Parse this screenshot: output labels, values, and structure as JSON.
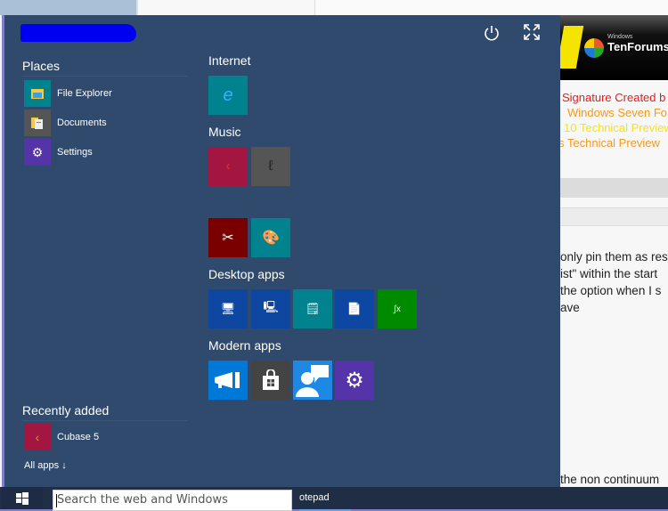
{
  "start_menu": {
    "user_name": "[redacted]",
    "power_icon": "power-icon",
    "expand_icon": "expand-icon",
    "places": {
      "heading": "Places",
      "items": [
        {
          "label": "File Explorer",
          "icon": "folder-icon",
          "color": "#00838f"
        },
        {
          "label": "Documents",
          "icon": "documents-icon",
          "color": "#555555"
        },
        {
          "label": "Settings",
          "icon": "gear-icon",
          "color": "#5533a8"
        }
      ]
    },
    "recently_added": {
      "heading": "Recently added",
      "items": [
        {
          "label": "Cubase 5",
          "icon": "cubase-icon",
          "color": "#a31642"
        }
      ]
    },
    "all_apps_label": "All apps ↓",
    "groups": [
      {
        "heading": "Internet",
        "tiles": [
          {
            "name": "internet-explorer",
            "icon": "ie-icon",
            "color": "#00838f"
          }
        ]
      },
      {
        "heading": "Music",
        "tiles": [
          {
            "name": "cubase",
            "icon": "cubase-icon",
            "color": "#a31642"
          },
          {
            "name": "mic-app",
            "icon": "microphone-icon",
            "color": "#555555"
          },
          {
            "name": "snipping-tool",
            "icon": "snipping-icon",
            "color": "#7a0000"
          },
          {
            "name": "paint",
            "icon": "paint-icon",
            "color": "#00838f"
          }
        ]
      },
      {
        "heading": "Desktop apps",
        "tiles": [
          {
            "name": "remote-desktop",
            "icon": "remote-desktop-icon",
            "color": "#0d47a1"
          },
          {
            "name": "computer",
            "icon": "computer-icon",
            "color": "#0d47a1"
          },
          {
            "name": "notepad",
            "icon": "notepad-icon",
            "color": "#00838f"
          },
          {
            "name": "wordpad",
            "icon": "wordpad-icon",
            "color": "#0d47a1"
          },
          {
            "name": "math-input",
            "icon": "math-icon",
            "color": "#008a00"
          }
        ]
      },
      {
        "heading": "Modern apps",
        "tiles": [
          {
            "name": "feedback",
            "icon": "megaphone-icon",
            "color": "#0078d7"
          },
          {
            "name": "store",
            "icon": "store-icon",
            "color": "#444444"
          },
          {
            "name": "contact-support",
            "icon": "contact-icon",
            "color": "#1e88e5"
          },
          {
            "name": "pc-settings",
            "icon": "gear-icon",
            "color": "#5533a8"
          }
        ]
      }
    ]
  },
  "background_page": {
    "banner_small": "Windows",
    "banner_large": "TenForums",
    "signature_lines": [
      {
        "text": "Signature Created b",
        "color": "#e81b1b"
      },
      {
        "text": "Windows Seven Fo",
        "color": "#f39a1e"
      },
      {
        "text": "10 Technical Preview",
        "color": "#f5e31a"
      },
      {
        "text": "s Technical Preview",
        "color": "#f39a1e"
      }
    ],
    "post_lines": [
      "only pin them as res",
      "ist\" within the start",
      "the option when I s",
      "ave"
    ],
    "bottom_line": "the non continuum"
  },
  "taskbar": {
    "search_placeholder": "Search the web and Windows",
    "running_app": "otepad"
  }
}
